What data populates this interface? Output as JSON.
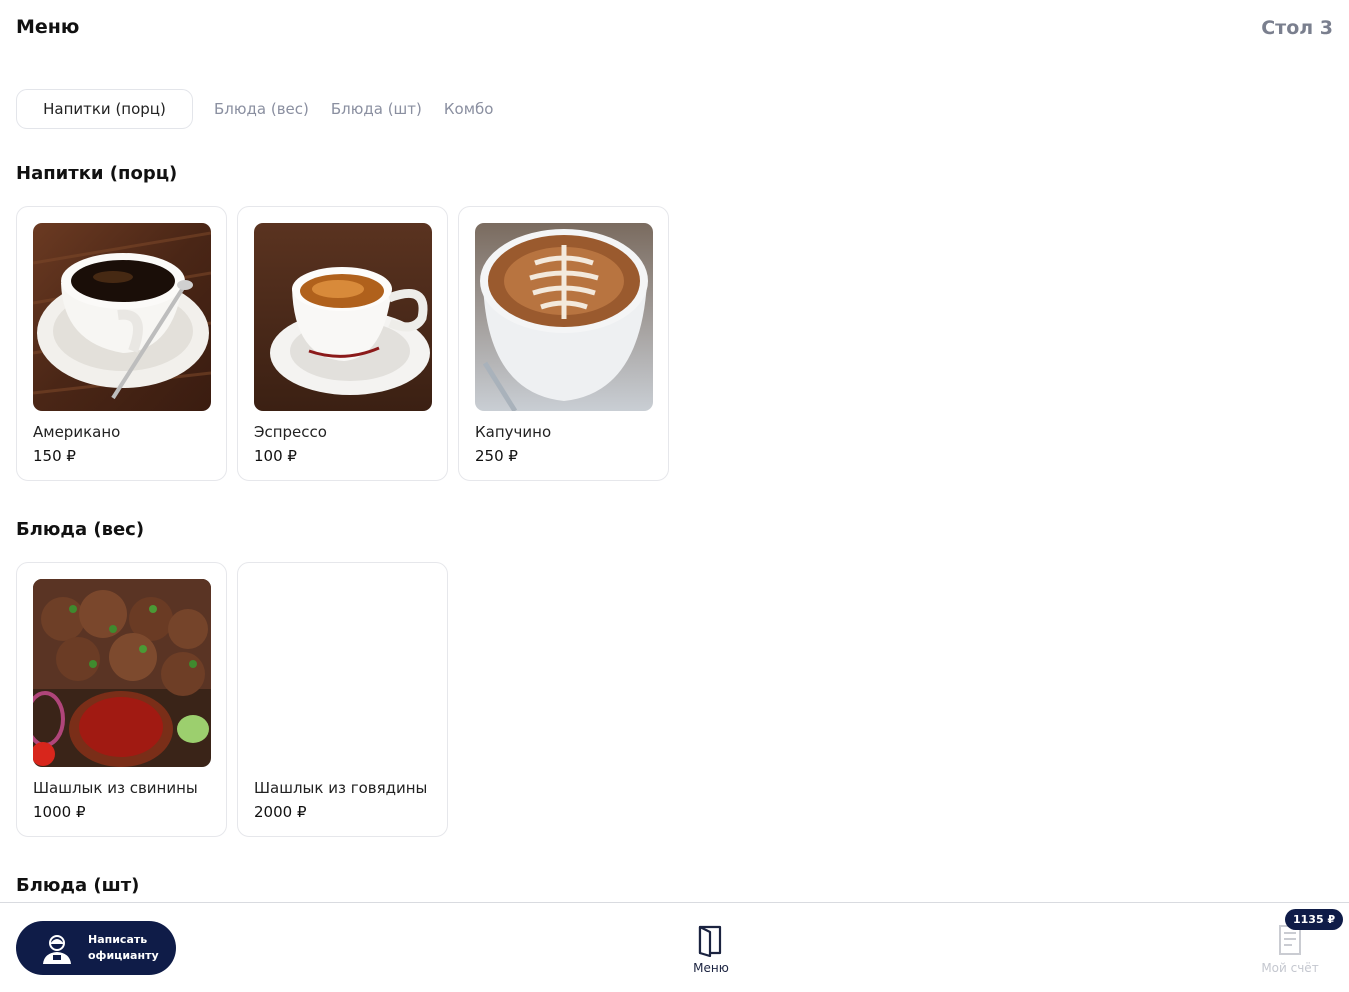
{
  "header": {
    "title": "Меню",
    "table": "Стол 3"
  },
  "tabs": [
    {
      "label": "Напитки (порц)",
      "active": true
    },
    {
      "label": "Блюда (вес)",
      "active": false
    },
    {
      "label": "Блюда (шт)",
      "active": false
    },
    {
      "label": "Комбо",
      "active": false
    }
  ],
  "sections": [
    {
      "title": "Напитки (порц)",
      "items": [
        {
          "name": "Американо",
          "price": "150 ₽",
          "image": "americano-photo"
        },
        {
          "name": "Эспрессо",
          "price": "100 ₽",
          "image": "espresso-photo"
        },
        {
          "name": "Капучино",
          "price": "250 ₽",
          "image": "cappuccino-photo"
        }
      ]
    },
    {
      "title": "Блюда (вес)",
      "items": [
        {
          "name": "Шашлык из свинины",
          "price": "1000 ₽",
          "image": "pork-shashlik-photo"
        },
        {
          "name": "Шашлык из говядины",
          "price": "2000 ₽",
          "image": ""
        }
      ]
    },
    {
      "title": "Блюда (шт)",
      "items": []
    }
  ],
  "bottom_bar": {
    "waiter_button": {
      "line1": "Написать",
      "line2": "официанту",
      "icon": "waiter-icon"
    },
    "nav_menu": {
      "label": "Меню",
      "icon": "menu-book-icon"
    },
    "nav_bill": {
      "label": "Мой счёт",
      "icon": "bill-icon",
      "badge": "1135 ₽"
    }
  },
  "colors": {
    "accent_dark": "#0f1c48",
    "muted_text": "#8a8fa0",
    "card_border": "#e6e7eb"
  }
}
